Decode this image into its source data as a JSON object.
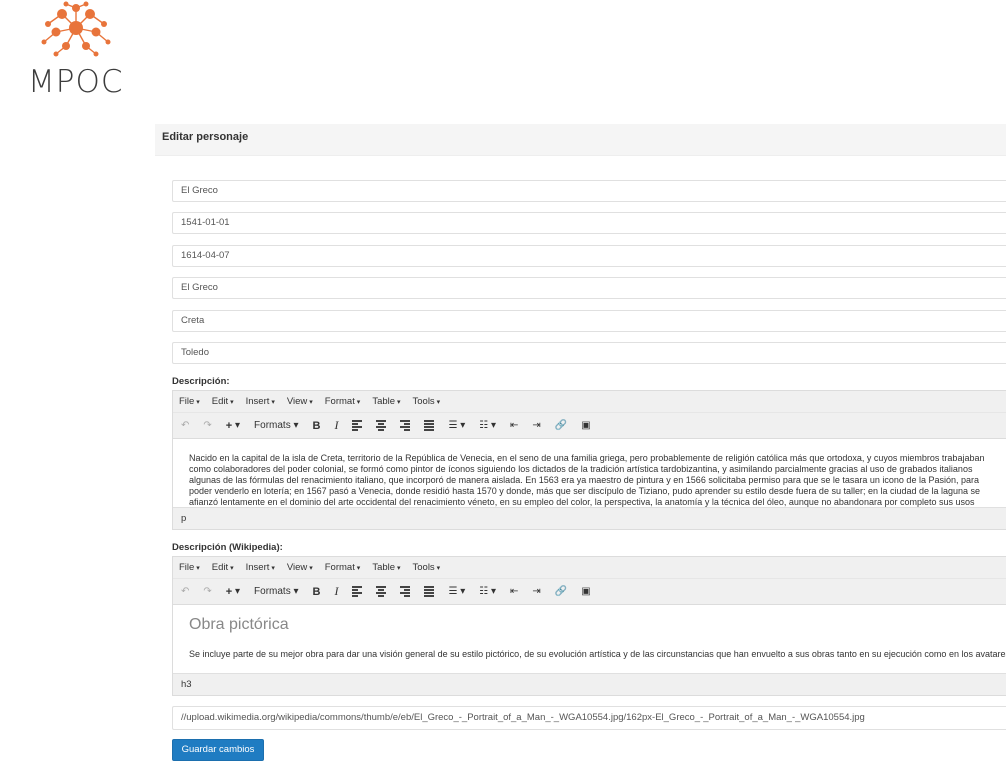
{
  "logo": {
    "text": "MPOC",
    "accent": "#e8743b"
  },
  "panel": {
    "title": "Editar personaje"
  },
  "fields": [
    {
      "value": "El Greco"
    },
    {
      "value": "1541-01-01"
    },
    {
      "value": "1614-04-07"
    },
    {
      "value": "El Greco"
    },
    {
      "value": "Creta"
    },
    {
      "value": "Toledo"
    }
  ],
  "descripcion": {
    "label": "Descripción:",
    "menu": [
      "File",
      "Edit",
      "Insert",
      "View",
      "Format",
      "Table",
      "Tools"
    ],
    "formats_label": "Formats",
    "content": "Nacido en la capital de la isla de Creta, territorio de la República de Venecia, en el seno de una familia griega, pero probablemente de religión católica más que ortodoxa, y cuyos miembros trabajaban como colaboradores del poder colonial, se formó como pintor de íconos siguiendo los dictados de la tradición artística tardobizantina, y asimilando parcialmente gracias al uso de grabados italianos algunas de las fórmulas del renacimiento italiano, que incorporó de manera aislada. En 1563 era ya maestro de pintura y en 1566 solicitaba permiso para que se le tasara un icono de la Pasión, para poder venderlo en lotería; en 1567 pasó a Venecia, donde residió hasta 1570 y donde, más que ser discípulo de Tiziano, pudo aprender su estilo desde fuera de su taller; en la ciudad de la laguna se afianzó lentamente en el dominio del arte occidental del renacimiento véneto, en su empleo del color, la perspectiva, la anatomía y la técnica del óleo, aunque no abandonara por completo sus usos tradicionales.",
    "status": "p"
  },
  "wikipedia": {
    "label": "Descripción (Wikipedia):",
    "menu": [
      "File",
      "Edit",
      "Insert",
      "View",
      "Format",
      "Table",
      "Tools"
    ],
    "formats_label": "Formats",
    "heading": "Obra pictórica",
    "content": "Se incluye parte de su mejor obra para dar una visión general de su estilo pictórico, de su evolución artística y de las circunstancias que han envuelto a sus obras tanto en su ejecución como en los avatares",
    "status": "h3"
  },
  "image_url": {
    "value": "//upload.wikimedia.org/wikipedia/commons/thumb/e/eb/El_Greco_-_Portrait_of_a_Man_-_WGA10554.jpg/162px-El_Greco_-_Portrait_of_a_Man_-_WGA10554.jpg"
  },
  "submit": {
    "label": "Guardar cambios",
    "color": "#1f7cc2"
  }
}
